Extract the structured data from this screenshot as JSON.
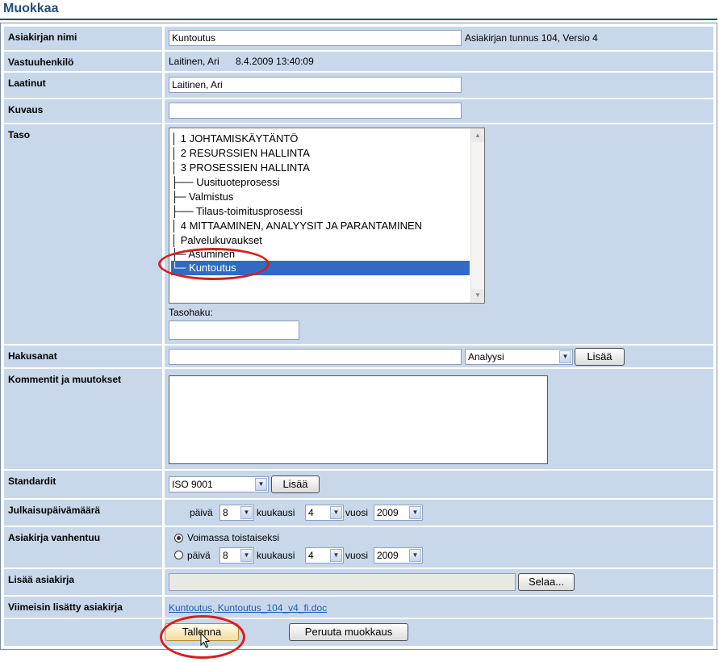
{
  "page_title": "Muokkaa",
  "fields": {
    "name": {
      "label": "Asiakirjan nimi",
      "value": "Kuntoutus",
      "info": "Asiakirjan tunnus 104, Versio 4"
    },
    "responsible": {
      "label": "Vastuuhenkilö",
      "person": "Laitinen, Ari",
      "datetime": "8.4.2009 13:40:09"
    },
    "author": {
      "label": "Laatinut",
      "value": "Laitinen, Ari"
    },
    "description": {
      "label": "Kuvaus",
      "value": ""
    },
    "level": {
      "label": "Taso",
      "items": [
        {
          "text": "│ 1 JOHTAMISKÄYTÄNTÖ",
          "selected": false
        },
        {
          "text": "│ 2 RESURSSIEN HALLINTA",
          "selected": false
        },
        {
          "text": "│ 3 PROSESSIEN HALLINTA",
          "selected": false
        },
        {
          "text": "├── Uusituoteprosessi",
          "selected": false
        },
        {
          "text": "├─ Valmistus",
          "selected": false
        },
        {
          "text": "├── Tilaus-toimitusprosessi",
          "selected": false
        },
        {
          "text": "│ 4 MITTAAMINEN, ANALYYSIT JA PARANTAMINEN",
          "selected": false
        },
        {
          "text": "│ Palvelukuvaukset",
          "selected": false
        },
        {
          "text": "├─ Asuminen",
          "selected": false
        },
        {
          "text": "└─ Kuntoutus",
          "selected": true
        }
      ],
      "search_label": "Tasohaku:",
      "search_value": ""
    },
    "keywords": {
      "label": "Hakusanat",
      "value": "",
      "select_value": "Analyysi",
      "add_label": "Lisää"
    },
    "comments": {
      "label": "Kommentit ja muutokset",
      "value": ""
    },
    "standards": {
      "label": "Standardit",
      "select_value": "ISO 9001",
      "add_label": "Lisää"
    },
    "publish_date": {
      "label": "Julkaisupäivämäärä",
      "day_label": "päivä",
      "day": "8",
      "month_label": "kuukausi",
      "month": "4",
      "year_label": "vuosi",
      "year": "2009"
    },
    "expiry": {
      "label": "Asiakirja vanhentuu",
      "option_valid": "Voimassa toistaiseksi",
      "day_label": "päivä",
      "day": "8",
      "month_label": "kuukausi",
      "month": "4",
      "year_label": "vuosi",
      "year": "2009"
    },
    "add_document": {
      "label": "Lisää asiakirja",
      "browse_label": "Selaa..."
    },
    "latest_document": {
      "label": "Viimeisin lisätty asiakirja",
      "link_text": "Kuntoutus, Kuntoutus_104_v4_fi.doc"
    }
  },
  "actions": {
    "save_label": "Tallenna",
    "cancel_label": "Peruuta muokkaus"
  },
  "colors": {
    "label_bg": "#c9d7ea",
    "title": "#1f4f7a",
    "selection": "#316ac5",
    "highlight_ellipse": "#d71f1f",
    "link": "#1f5fb0"
  }
}
